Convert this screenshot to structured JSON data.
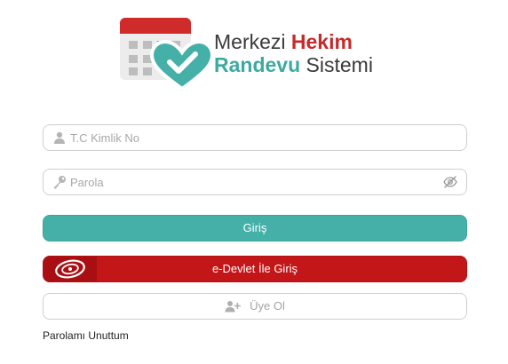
{
  "logo": {
    "line1_word1": "Merkezi",
    "line1_word2": "Hekim",
    "line2_word1": "Randevu",
    "line2_word2": "Sistemi"
  },
  "form": {
    "tc_placeholder": "T.C Kimlik No",
    "password_placeholder": "Parola",
    "login_label": "Giriş",
    "edevlet_label": "e-Devlet İle Giriş",
    "register_label": "Üye Ol",
    "forgot_label": "Parolamı Unuttum"
  },
  "colors": {
    "teal": "#45b0a8",
    "red": "#c31618",
    "logo_red": "#c62a2a",
    "logo_teal": "#3daaa2"
  },
  "icons": {
    "tc": "user-icon",
    "password": "key-icon",
    "toggle": "eye-slash-icon",
    "register": "user-plus-icon",
    "edevlet": "edevlet-logo"
  }
}
